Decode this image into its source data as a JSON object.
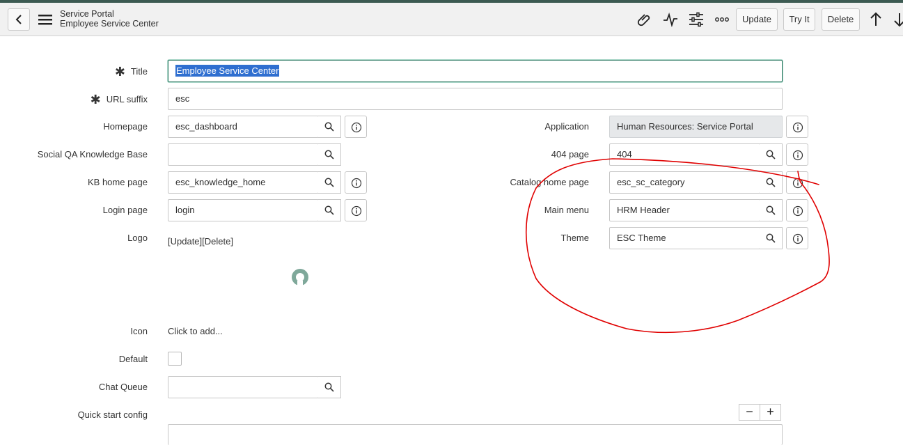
{
  "header": {
    "title": "Service Portal",
    "subtitle": "Employee Service Center",
    "buttons": {
      "update": "Update",
      "try_it": "Try It",
      "delete": "Delete"
    },
    "icons": [
      "back-icon",
      "hamburger-menu-icon",
      "paperclip-icon",
      "activity-icon",
      "sliders-icon",
      "more-options-icon",
      "arrow-up-icon",
      "arrow-down-icon"
    ]
  },
  "form": {
    "title": {
      "label": "Title",
      "value": "Employee Service Center",
      "required": true
    },
    "url_suffix": {
      "label": "URL suffix",
      "value": "esc",
      "required": true
    },
    "homepage": {
      "label": "Homepage",
      "value": "esc_dashboard"
    },
    "social_qa": {
      "label": "Social QA Knowledge Base",
      "value": ""
    },
    "kb_home": {
      "label": "KB home page",
      "value": "esc_knowledge_home"
    },
    "login_page": {
      "label": "Login page",
      "value": "login"
    },
    "logo": {
      "label": "Logo",
      "value": "[Update][Delete]"
    },
    "icon": {
      "label": "Icon",
      "value": "Click to add..."
    },
    "default": {
      "label": "Default",
      "checked": false
    },
    "chat_queue": {
      "label": "Chat Queue",
      "value": ""
    },
    "quick_start": {
      "label": "Quick start config",
      "minus": "−",
      "plus": "+"
    },
    "application": {
      "label": "Application",
      "value": "Human Resources: Service Portal"
    },
    "page_404": {
      "label": "404 page",
      "value": "404"
    },
    "catalog_home": {
      "label": "Catalog home page",
      "value": "esc_sc_category"
    },
    "main_menu": {
      "label": "Main menu",
      "value": "HRM Header"
    },
    "theme": {
      "label": "Theme",
      "value": "ESC Theme"
    }
  },
  "colors": {
    "accent": "#2f7a63",
    "selection": "#2f6fd0",
    "annotation": "#e00000",
    "header_bg": "#f1f1f1",
    "spinner": "#7fa89a"
  }
}
